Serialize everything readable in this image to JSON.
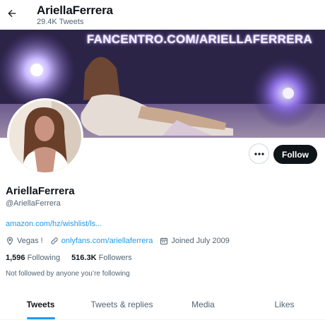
{
  "header": {
    "title": "AriellaFerrera",
    "tweet_count": "29.4K Tweets"
  },
  "banner": {
    "text": "FANCENTRO.COM/ARIELLAFERRERA"
  },
  "actions": {
    "follow_label": "Follow"
  },
  "profile": {
    "display_name": "AriellaFerrera",
    "handle": "@AriellaFerrera",
    "bio_link": "amazon.com/hz/wishlist/ls...",
    "location": "Vegas !",
    "website": "onlyfans.com/ariellaferrera",
    "joined": "Joined July 2009",
    "following_count": "1,596",
    "following_label": "Following",
    "followers_count": "516.3K",
    "followers_label": "Followers",
    "not_followed_note": "Not followed by anyone you’re following"
  },
  "tabs": [
    {
      "label": "Tweets",
      "active": true
    },
    {
      "label": "Tweets & replies",
      "active": false
    },
    {
      "label": "Media",
      "active": false
    },
    {
      "label": "Likes",
      "active": false
    }
  ],
  "icons": {
    "back": "arrow-left-icon",
    "more": "more-horizontal-icon",
    "location": "location-pin-icon",
    "website": "link-icon",
    "joined": "calendar-icon"
  },
  "colors": {
    "accent": "#1d9bf0",
    "text_primary": "#0f1419",
    "text_secondary": "#536471",
    "follow_bg": "#0f1419"
  }
}
